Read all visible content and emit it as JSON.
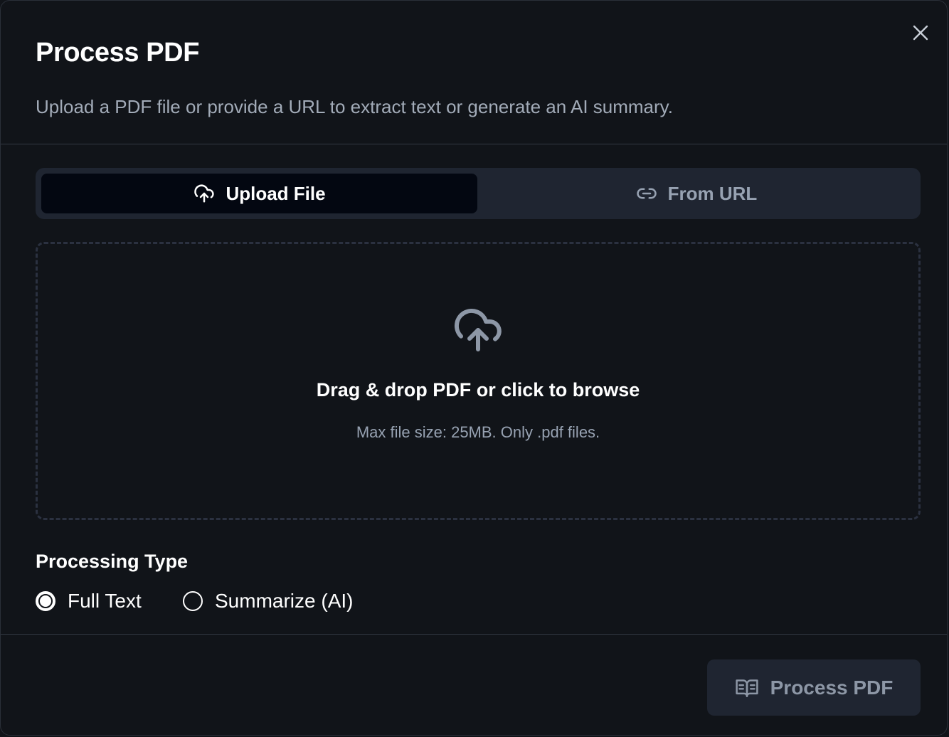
{
  "dialog": {
    "title": "Process PDF",
    "description": "Upload a PDF file or provide a URL to extract text or generate an AI summary.",
    "close_icon": "close-icon"
  },
  "tabs": [
    {
      "label": "Upload File",
      "icon": "cloud-upload-icon",
      "active": true
    },
    {
      "label": "From URL",
      "icon": "link-icon",
      "active": false
    }
  ],
  "dropzone": {
    "icon": "cloud-upload-icon",
    "title": "Drag & drop PDF or click to browse",
    "subtitle": "Max file size: 25MB. Only .pdf files."
  },
  "processing": {
    "label": "Processing Type",
    "options": [
      {
        "label": "Full Text",
        "selected": true
      },
      {
        "label": "Summarize (AI)",
        "selected": false
      }
    ]
  },
  "footer": {
    "submit_label": "Process PDF",
    "submit_icon": "book-open-icon",
    "submit_disabled": true
  },
  "colors": {
    "background": "#111419",
    "tab_track": "#1f2531",
    "tab_active": "#030711",
    "text_primary": "#ffffff",
    "text_muted": "#97a2b2",
    "border": "#333944",
    "button_disabled_bg": "#1f2531",
    "button_disabled_text": "#8d97a6"
  }
}
